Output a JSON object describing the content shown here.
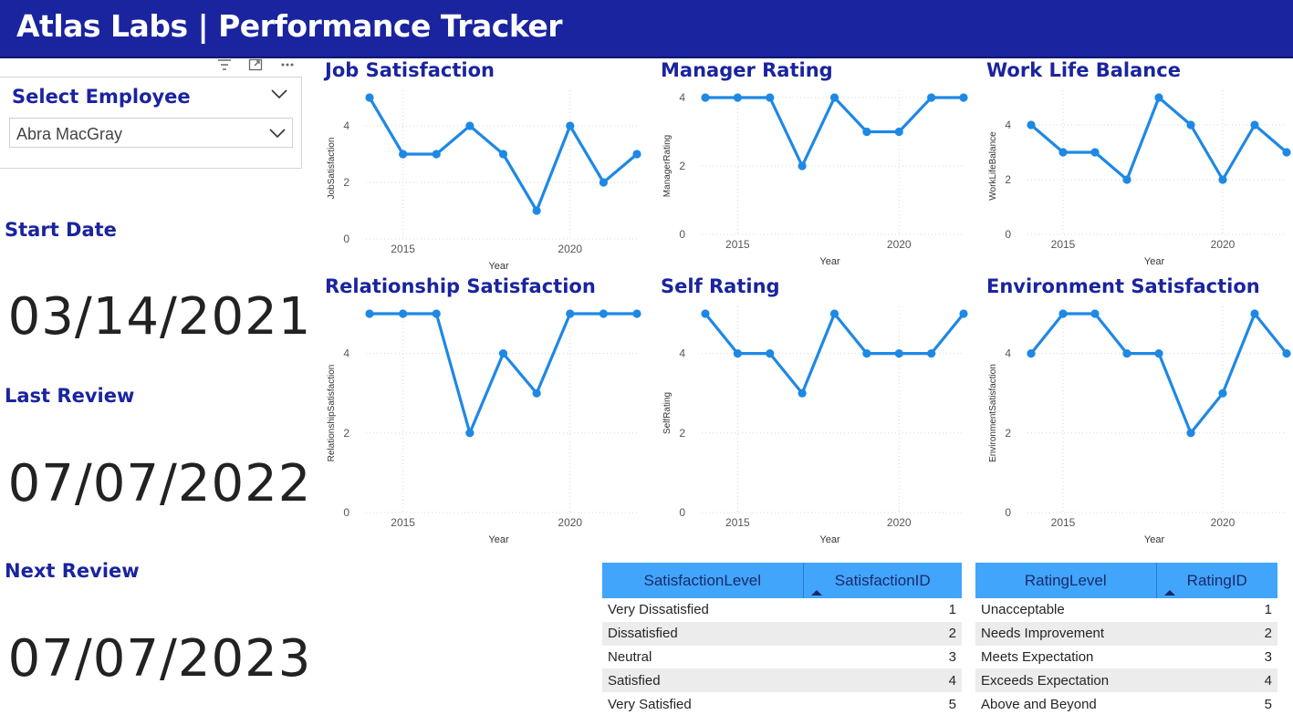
{
  "header": {
    "title": "Atlas Labs | Performance Tracker"
  },
  "slicer": {
    "title": "Select Employee",
    "value": "Abra MacGray"
  },
  "kpis": [
    {
      "label": "Start Date",
      "value": "03/14/2021"
    },
    {
      "label": "Last Review",
      "value": "07/07/2022"
    },
    {
      "label": "Next Review",
      "value": "07/07/2023"
    }
  ],
  "colors": {
    "brand": "#1a249e",
    "line": "#1e88e5",
    "table_header": "#41a5fc"
  },
  "chart_data": [
    {
      "type": "line",
      "title": "Job Satisfaction",
      "xlabel": "Year",
      "ylabel": "JobSatisfaction",
      "x": [
        2014,
        2015,
        2016,
        2017,
        2018,
        2019,
        2020,
        2021,
        2022
      ],
      "y": [
        5,
        3,
        3,
        4,
        3,
        1,
        4,
        2,
        3
      ],
      "xticks": [
        2015,
        2020
      ],
      "yticks": [
        0,
        2,
        4
      ],
      "ylim": [
        0,
        5
      ],
      "grid": true
    },
    {
      "type": "line",
      "title": "Manager Rating",
      "xlabel": "Year",
      "ylabel": "ManagerRating",
      "x": [
        2014,
        2015,
        2016,
        2017,
        2018,
        2019,
        2020,
        2021,
        2022
      ],
      "y": [
        4,
        4,
        4,
        2,
        4,
        3,
        3,
        4,
        4
      ],
      "xticks": [
        2015,
        2020
      ],
      "yticks": [
        0,
        2,
        4
      ],
      "ylim": [
        0,
        4
      ],
      "grid": true
    },
    {
      "type": "line",
      "title": "Work Life Balance",
      "xlabel": "Year",
      "ylabel": "WorkLifeBalance",
      "x": [
        2014,
        2015,
        2016,
        2017,
        2018,
        2019,
        2020,
        2021,
        2022
      ],
      "y": [
        4,
        3,
        3,
        2,
        5,
        4,
        2,
        4,
        3
      ],
      "xticks": [
        2015,
        2020
      ],
      "yticks": [
        0,
        2,
        4
      ],
      "ylim": [
        0,
        5
      ],
      "grid": true
    },
    {
      "type": "line",
      "title": "Relationship Satisfaction",
      "xlabel": "Year",
      "ylabel": "RelationshipSatisfaction",
      "x": [
        2014,
        2015,
        2016,
        2017,
        2018,
        2019,
        2020,
        2021,
        2022
      ],
      "y": [
        5,
        5,
        5,
        2,
        4,
        3,
        5,
        5,
        5
      ],
      "xticks": [
        2015,
        2020
      ],
      "yticks": [
        0,
        2,
        4
      ],
      "ylim": [
        0,
        5
      ],
      "grid": true
    },
    {
      "type": "line",
      "title": "Self Rating",
      "xlabel": "Year",
      "ylabel": "SelfRating",
      "x": [
        2014,
        2015,
        2016,
        2017,
        2018,
        2019,
        2020,
        2021,
        2022
      ],
      "y": [
        5,
        4,
        4,
        3,
        5,
        4,
        4,
        4,
        5
      ],
      "xticks": [
        2015,
        2020
      ],
      "yticks": [
        0,
        2,
        4
      ],
      "ylim": [
        0,
        5
      ],
      "grid": true
    },
    {
      "type": "line",
      "title": "Environment Satisfaction",
      "xlabel": "Year",
      "ylabel": "EnvironmentSatisfaction",
      "x": [
        2014,
        2015,
        2016,
        2017,
        2018,
        2019,
        2020,
        2021,
        2022
      ],
      "y": [
        4,
        5,
        5,
        4,
        4,
        2,
        3,
        5,
        4
      ],
      "xticks": [
        2015,
        2020
      ],
      "yticks": [
        0,
        2,
        4
      ],
      "ylim": [
        0,
        5
      ],
      "grid": true
    }
  ],
  "tables": {
    "satisfaction": {
      "columns": [
        "SatisfactionLevel",
        "SatisfactionID"
      ],
      "rows": [
        [
          "Very Dissatisfied",
          "1"
        ],
        [
          "Dissatisfied",
          "2"
        ],
        [
          "Neutral",
          "3"
        ],
        [
          "Satisfied",
          "4"
        ],
        [
          "Very Satisfied",
          "5"
        ]
      ]
    },
    "rating": {
      "columns": [
        "RatingLevel",
        "RatingID"
      ],
      "rows": [
        [
          "Unacceptable",
          "1"
        ],
        [
          "Needs Improvement",
          "2"
        ],
        [
          "Meets Expectation",
          "3"
        ],
        [
          "Exceeds Expectation",
          "4"
        ],
        [
          "Above and Beyond",
          "5"
        ]
      ]
    }
  }
}
